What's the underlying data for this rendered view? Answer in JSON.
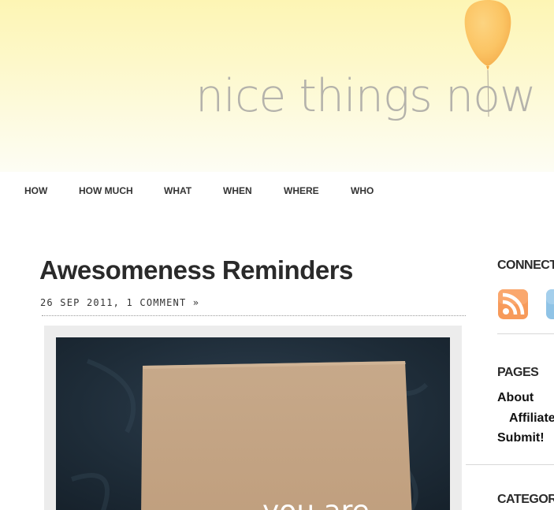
{
  "site": {
    "title": "nice things now"
  },
  "nav": {
    "items": [
      "HOW",
      "HOW MUCH",
      "WHAT",
      "WHEN",
      "WHERE",
      "WHO"
    ]
  },
  "post": {
    "title": "Awesomeness Reminders",
    "date": "26 SEP 2011,",
    "comments_link": "1 COMMENT »",
    "image_text": "you are"
  },
  "sidebar": {
    "connect_title": "CONNECT",
    "connect_icons": [
      "rss-feed-icon",
      "social-icon"
    ],
    "pages_title": "PAGES",
    "pages": [
      "About",
      "Affiliate",
      "Submit!"
    ],
    "categories_title": "CATEGOR"
  },
  "colors": {
    "header_yellow": "#fdf5b4",
    "title_gray": "#b4b2ab",
    "balloon_orange": "#fbbf5a",
    "rss_orange": "#f79a5a"
  }
}
